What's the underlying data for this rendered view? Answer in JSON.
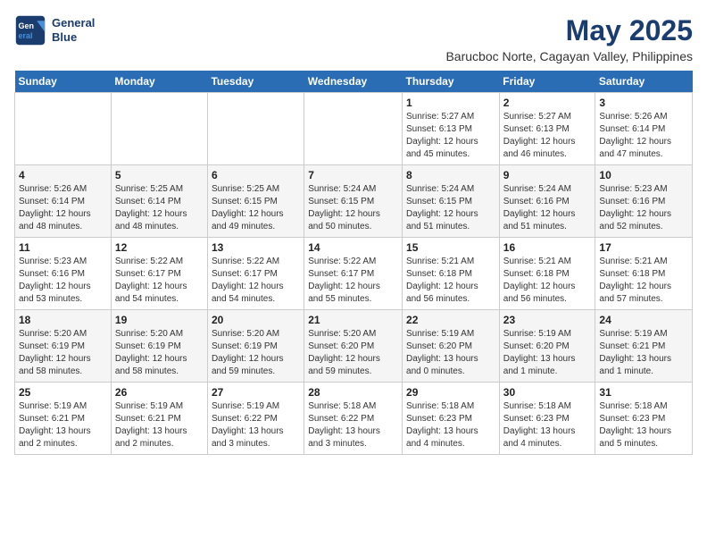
{
  "header": {
    "logo_line1": "General",
    "logo_line2": "Blue",
    "month": "May 2025",
    "location": "Barucboc Norte, Cagayan Valley, Philippines"
  },
  "days_of_week": [
    "Sunday",
    "Monday",
    "Tuesday",
    "Wednesday",
    "Thursday",
    "Friday",
    "Saturday"
  ],
  "weeks": [
    [
      {
        "day": "",
        "info": ""
      },
      {
        "day": "",
        "info": ""
      },
      {
        "day": "",
        "info": ""
      },
      {
        "day": "",
        "info": ""
      },
      {
        "day": "1",
        "info": "Sunrise: 5:27 AM\nSunset: 6:13 PM\nDaylight: 12 hours\nand 45 minutes."
      },
      {
        "day": "2",
        "info": "Sunrise: 5:27 AM\nSunset: 6:13 PM\nDaylight: 12 hours\nand 46 minutes."
      },
      {
        "day": "3",
        "info": "Sunrise: 5:26 AM\nSunset: 6:14 PM\nDaylight: 12 hours\nand 47 minutes."
      }
    ],
    [
      {
        "day": "4",
        "info": "Sunrise: 5:26 AM\nSunset: 6:14 PM\nDaylight: 12 hours\nand 48 minutes."
      },
      {
        "day": "5",
        "info": "Sunrise: 5:25 AM\nSunset: 6:14 PM\nDaylight: 12 hours\nand 48 minutes."
      },
      {
        "day": "6",
        "info": "Sunrise: 5:25 AM\nSunset: 6:15 PM\nDaylight: 12 hours\nand 49 minutes."
      },
      {
        "day": "7",
        "info": "Sunrise: 5:24 AM\nSunset: 6:15 PM\nDaylight: 12 hours\nand 50 minutes."
      },
      {
        "day": "8",
        "info": "Sunrise: 5:24 AM\nSunset: 6:15 PM\nDaylight: 12 hours\nand 51 minutes."
      },
      {
        "day": "9",
        "info": "Sunrise: 5:24 AM\nSunset: 6:16 PM\nDaylight: 12 hours\nand 51 minutes."
      },
      {
        "day": "10",
        "info": "Sunrise: 5:23 AM\nSunset: 6:16 PM\nDaylight: 12 hours\nand 52 minutes."
      }
    ],
    [
      {
        "day": "11",
        "info": "Sunrise: 5:23 AM\nSunset: 6:16 PM\nDaylight: 12 hours\nand 53 minutes."
      },
      {
        "day": "12",
        "info": "Sunrise: 5:22 AM\nSunset: 6:17 PM\nDaylight: 12 hours\nand 54 minutes."
      },
      {
        "day": "13",
        "info": "Sunrise: 5:22 AM\nSunset: 6:17 PM\nDaylight: 12 hours\nand 54 minutes."
      },
      {
        "day": "14",
        "info": "Sunrise: 5:22 AM\nSunset: 6:17 PM\nDaylight: 12 hours\nand 55 minutes."
      },
      {
        "day": "15",
        "info": "Sunrise: 5:21 AM\nSunset: 6:18 PM\nDaylight: 12 hours\nand 56 minutes."
      },
      {
        "day": "16",
        "info": "Sunrise: 5:21 AM\nSunset: 6:18 PM\nDaylight: 12 hours\nand 56 minutes."
      },
      {
        "day": "17",
        "info": "Sunrise: 5:21 AM\nSunset: 6:18 PM\nDaylight: 12 hours\nand 57 minutes."
      }
    ],
    [
      {
        "day": "18",
        "info": "Sunrise: 5:20 AM\nSunset: 6:19 PM\nDaylight: 12 hours\nand 58 minutes."
      },
      {
        "day": "19",
        "info": "Sunrise: 5:20 AM\nSunset: 6:19 PM\nDaylight: 12 hours\nand 58 minutes."
      },
      {
        "day": "20",
        "info": "Sunrise: 5:20 AM\nSunset: 6:19 PM\nDaylight: 12 hours\nand 59 minutes."
      },
      {
        "day": "21",
        "info": "Sunrise: 5:20 AM\nSunset: 6:20 PM\nDaylight: 12 hours\nand 59 minutes."
      },
      {
        "day": "22",
        "info": "Sunrise: 5:19 AM\nSunset: 6:20 PM\nDaylight: 13 hours\nand 0 minutes."
      },
      {
        "day": "23",
        "info": "Sunrise: 5:19 AM\nSunset: 6:20 PM\nDaylight: 13 hours\nand 1 minute."
      },
      {
        "day": "24",
        "info": "Sunrise: 5:19 AM\nSunset: 6:21 PM\nDaylight: 13 hours\nand 1 minute."
      }
    ],
    [
      {
        "day": "25",
        "info": "Sunrise: 5:19 AM\nSunset: 6:21 PM\nDaylight: 13 hours\nand 2 minutes."
      },
      {
        "day": "26",
        "info": "Sunrise: 5:19 AM\nSunset: 6:21 PM\nDaylight: 13 hours\nand 2 minutes."
      },
      {
        "day": "27",
        "info": "Sunrise: 5:19 AM\nSunset: 6:22 PM\nDaylight: 13 hours\nand 3 minutes."
      },
      {
        "day": "28",
        "info": "Sunrise: 5:18 AM\nSunset: 6:22 PM\nDaylight: 13 hours\nand 3 minutes."
      },
      {
        "day": "29",
        "info": "Sunrise: 5:18 AM\nSunset: 6:23 PM\nDaylight: 13 hours\nand 4 minutes."
      },
      {
        "day": "30",
        "info": "Sunrise: 5:18 AM\nSunset: 6:23 PM\nDaylight: 13 hours\nand 4 minutes."
      },
      {
        "day": "31",
        "info": "Sunrise: 5:18 AM\nSunset: 6:23 PM\nDaylight: 13 hours\nand 5 minutes."
      }
    ]
  ]
}
